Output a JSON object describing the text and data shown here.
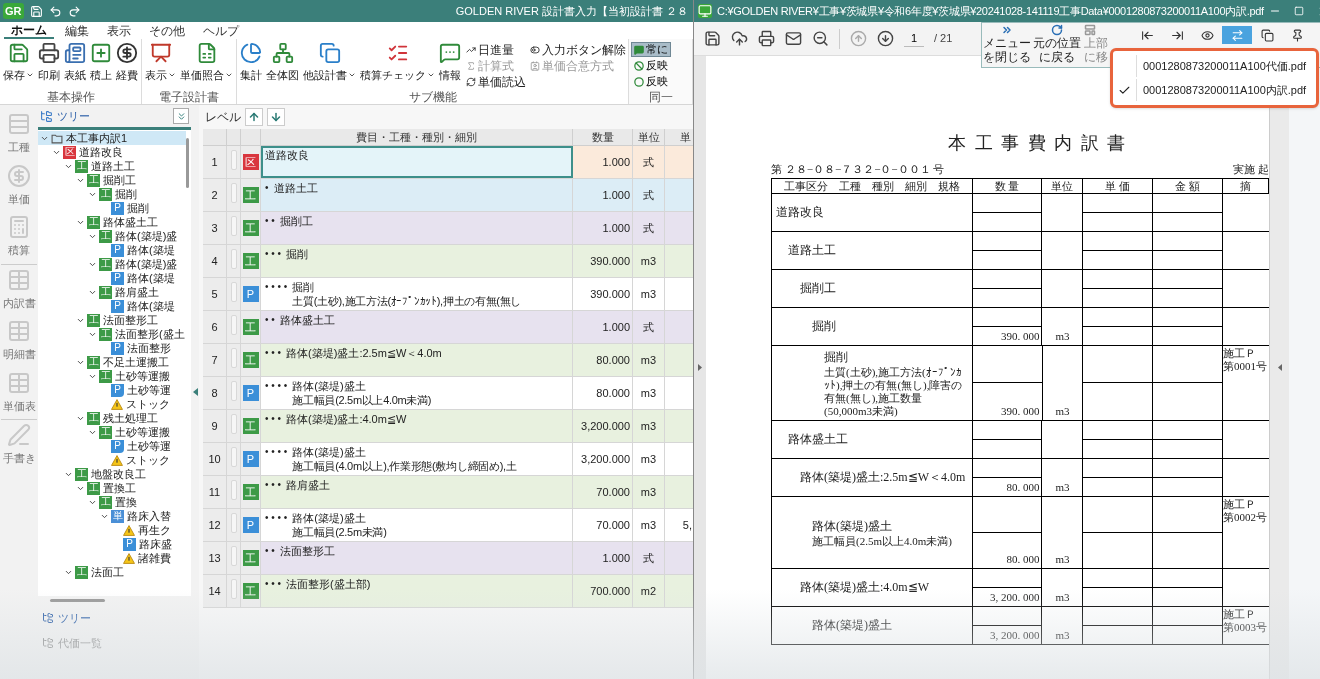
{
  "app": {
    "logo": "GR",
    "title": "GOLDEN RIVER 設計書入力【当初設計書 ２８",
    "tabs": [
      {
        "label": "ホーム",
        "selected": true
      },
      {
        "label": "編集",
        "selected": false
      },
      {
        "label": "表示",
        "selected": false
      },
      {
        "label": "その他",
        "selected": false
      },
      {
        "label": "ヘルプ",
        "selected": false
      }
    ],
    "ribbon": [
      {
        "label": "基本操作",
        "buttons": [
          {
            "label": "保存",
            "dropdown": true
          },
          {
            "label": "印刷",
            "dropdown": false
          },
          {
            "label": "表紙",
            "dropdown": false
          },
          {
            "label": "積上",
            "dropdown": false
          },
          {
            "label": "経費",
            "dropdown": false
          }
        ]
      },
      {
        "label": "電子設計書",
        "buttons": [
          {
            "label": "表示",
            "dropdown": true
          },
          {
            "label": "単価照合",
            "dropdown": true
          }
        ]
      },
      {
        "label": "サブ機能",
        "buttons": [
          {
            "label": "集計",
            "dropdown": false
          },
          {
            "label": "全体図",
            "dropdown": false
          },
          {
            "label": "他設計書",
            "dropdown": true
          },
          {
            "label": "積算チェック",
            "dropdown": true
          },
          {
            "label": "情報",
            "dropdown": false
          }
        ],
        "small": [
          {
            "label": "日進量",
            "disabled": false
          },
          {
            "label": "計算式",
            "disabled": true
          },
          {
            "label": "単価読込",
            "disabled": false
          },
          {
            "label": "入力ボタン解除",
            "disabled": false
          },
          {
            "label": "単価合意方式",
            "disabled": true
          }
        ]
      },
      {
        "label": "同一",
        "items": [
          {
            "label": "常に",
            "selected": true
          },
          {
            "label": "反映",
            "selected": false
          },
          {
            "label": "反映",
            "selected": false
          }
        ]
      }
    ],
    "nav": [
      "工種",
      "単価",
      "積算",
      "内訳書",
      "明細書",
      "単価表",
      "手書き"
    ],
    "tree": {
      "title": "ツリー",
      "nodes": [
        {
          "label": "本工事内訳1",
          "kind": "root",
          "expanded": true,
          "selected": true,
          "children": [
            {
              "label": "道路改良",
              "kind": "kubun",
              "badge": "区",
              "expanded": true,
              "selected": false,
              "children": [
                {
                  "label": "道路土工",
                  "kind": "kou",
                  "badge": "工",
                  "expanded": true,
                  "selected": false,
                  "children": [
                    {
                      "label": "掘削工",
                      "kind": "kou",
                      "badge": "工",
                      "expanded": true,
                      "selected": false,
                      "children": [
                        {
                          "label": "掘削",
                          "kind": "kou",
                          "badge": "工",
                          "expanded": true,
                          "selected": false,
                          "children": [
                            {
                              "label": "掘削",
                              "kind": "p",
                              "badge": "P",
                              "expanded": false,
                              "selected": false
                            }
                          ]
                        }
                      ]
                    },
                    {
                      "label": "路体盛土工",
                      "kind": "kou",
                      "badge": "工",
                      "expanded": true,
                      "selected": false,
                      "children": [
                        {
                          "label": "路体(築堤)盛",
                          "kind": "kou",
                          "badge": "工",
                          "expanded": true,
                          "selected": false,
                          "children": [
                            {
                              "label": "路体(築堤",
                              "kind": "p",
                              "badge": "P",
                              "expanded": false,
                              "selected": false
                            }
                          ]
                        },
                        {
                          "label": "路体(築堤)盛",
                          "kind": "kou",
                          "badge": "工",
                          "expanded": true,
                          "selected": false,
                          "children": [
                            {
                              "label": "路体(築堤",
                              "kind": "p",
                              "badge": "P",
                              "expanded": false,
                              "selected": false
                            }
                          ]
                        },
                        {
                          "label": "路肩盛土",
                          "kind": "kou",
                          "badge": "工",
                          "expanded": true,
                          "selected": false,
                          "children": [
                            {
                              "label": "路体(築堤",
                              "kind": "p",
                              "badge": "P",
                              "expanded": false,
                              "selected": false
                            }
                          ]
                        }
                      ]
                    },
                    {
                      "label": "法面整形工",
                      "kind": "kou",
                      "badge": "工",
                      "expanded": true,
                      "selected": false,
                      "children": [
                        {
                          "label": "法面整形(盛土",
                          "kind": "kou",
                          "badge": "工",
                          "expanded": true,
                          "selected": false,
                          "children": [
                            {
                              "label": "法面整形",
                              "kind": "p",
                              "badge": "P",
                              "expanded": false,
                              "selected": false
                            }
                          ]
                        }
                      ]
                    },
                    {
                      "label": "不足土運搬工",
                      "kind": "kou",
                      "badge": "工",
                      "expanded": true,
                      "selected": false,
                      "children": [
                        {
                          "label": "土砂等運搬",
                          "kind": "kou",
                          "badge": "工",
                          "expanded": true,
                          "selected": false,
                          "children": [
                            {
                              "label": "土砂等運",
                              "kind": "pedit",
                              "badge": "P",
                              "expanded": false,
                              "selected": false
                            },
                            {
                              "label": "ストック",
                              "kind": "warn",
                              "expanded": false,
                              "selected": false
                            }
                          ]
                        }
                      ]
                    },
                    {
                      "label": "残土処理工",
                      "kind": "kou",
                      "badge": "工",
                      "expanded": true,
                      "selected": false,
                      "children": [
                        {
                          "label": "土砂等運搬",
                          "kind": "kou",
                          "badge": "工",
                          "expanded": true,
                          "selected": false,
                          "children": [
                            {
                              "label": "土砂等運",
                              "kind": "pedit",
                              "badge": "P",
                              "expanded": false,
                              "selected": false
                            },
                            {
                              "label": "ストック",
                              "kind": "warn",
                              "expanded": false,
                              "selected": false
                            }
                          ]
                        }
                      ]
                    }
                  ]
                },
                {
                  "label": "地盤改良工",
                  "kind": "kou",
                  "badge": "工",
                  "expanded": true,
                  "selected": false,
                  "children": [
                    {
                      "label": "置換工",
                      "kind": "kou",
                      "badge": "工",
                      "expanded": true,
                      "selected": false,
                      "children": [
                        {
                          "label": "置換",
                          "kind": "kou",
                          "badge": "工",
                          "expanded": true,
                          "selected": false,
                          "children": [
                            {
                              "label": "路床入替",
                              "kind": "tan",
                              "badge": "単",
                              "expanded": true,
                              "selected": false,
                              "children": [
                                {
                                  "label": "再生ク",
                                  "kind": "warn",
                                  "expanded": false,
                                  "selected": false
                                },
                                {
                                  "label": "路床盛",
                                  "kind": "p",
                                  "badge": "P",
                                  "expanded": false,
                                  "selected": false
                                },
                                {
                                  "label": "諸雑費",
                                  "kind": "warn",
                                  "expanded": false,
                                  "selected": false
                                }
                              ]
                            }
                          ]
                        }
                      ]
                    }
                  ]
                },
                {
                  "label": "法面工",
                  "kind": "kou",
                  "badge": "工",
                  "expanded": true,
                  "selected": false
                }
              ]
            }
          ]
        }
      ]
    },
    "bottom_tabs": [
      "ツリー",
      "代価一覧"
    ],
    "grid": {
      "level_label": "レベル",
      "columns": [
        "費目・工種・種別・細別",
        "数量",
        "単位",
        "単"
      ],
      "rows": [
        {
          "no": "1",
          "kind": "kubun",
          "badge": "区",
          "name": "道路改良",
          "qty": "1.000",
          "unit": "式",
          "color": "#fbeadb",
          "selected": true
        },
        {
          "no": "2",
          "kind": "kou",
          "badge": "工",
          "marker": "•",
          "name": "道路土工",
          "qty": "1.000",
          "unit": "式",
          "color": "#dcedf6",
          "selected": false
        },
        {
          "no": "3",
          "kind": "kou",
          "badge": "工",
          "marker": "• •",
          "name": "掘削工",
          "qty": "1.000",
          "unit": "式",
          "color": "#e7e2ef",
          "selected": false
        },
        {
          "no": "4",
          "kind": "kou",
          "badge": "工",
          "marker": "• • •",
          "name": "掘削",
          "qty": "390.000",
          "unit": "m3",
          "color": "#e8f1df",
          "selected": false
        },
        {
          "no": "5",
          "kind": "p",
          "badge": "P",
          "marker": "• • • •",
          "name": "掘削",
          "detail": "土質(土砂),施工方法(ｵｰﾌﾟﾝｶｯﾄ),押土の有無(無し",
          "qty": "390.000",
          "unit": "m3",
          "color": "#ffffff",
          "selected": false
        },
        {
          "no": "6",
          "kind": "kou",
          "badge": "工",
          "marker": "• •",
          "name": "路体盛土工",
          "qty": "1.000",
          "unit": "式",
          "color": "#e7e2ef",
          "selected": false
        },
        {
          "no": "7",
          "kind": "kou",
          "badge": "工",
          "marker": "• • •",
          "name": "路体(築堤)盛土:2.5m≦W＜4.0m",
          "qty": "80.000",
          "unit": "m3",
          "color": "#e8f1df",
          "selected": false
        },
        {
          "no": "8",
          "kind": "p",
          "badge": "P",
          "marker": "• • • •",
          "name": "路体(築堤)盛土",
          "detail": "施工幅員(2.5m以上4.0m未満)",
          "qty": "80.000",
          "unit": "m3",
          "color": "#ffffff",
          "selected": false
        },
        {
          "no": "9",
          "kind": "kou",
          "badge": "工",
          "marker": "• • •",
          "name": "路体(築堤)盛土:4.0m≦W",
          "qty": "3,200.000",
          "unit": "m3",
          "color": "#e8f1df",
          "selected": false
        },
        {
          "no": "10",
          "kind": "p",
          "badge": "P",
          "marker": "• • • •",
          "name": "路体(築堤)盛土",
          "detail": "施工幅員(4.0m以上),作業形態(敷均し締固め),土",
          "qty": "3,200.000",
          "unit": "m3",
          "color": "#ffffff",
          "selected": false
        },
        {
          "no": "11",
          "kind": "kou",
          "badge": "工",
          "marker": "• • •",
          "name": "路肩盛土",
          "qty": "70.000",
          "unit": "m3",
          "color": "#e8f1df",
          "selected": false
        },
        {
          "no": "12",
          "kind": "p",
          "badge": "P",
          "marker": "• • • •",
          "name": "路体(築堤)盛土",
          "detail": "施工幅員(2.5m未満)",
          "qty": "70.000",
          "unit": "m3",
          "price": "5,",
          "color": "#ffffff",
          "selected": false
        },
        {
          "no": "13",
          "kind": "kou",
          "badge": "工",
          "marker": "• •",
          "name": "法面整形工",
          "qty": "1.000",
          "unit": "式",
          "color": "#e7e2ef",
          "selected": false
        },
        {
          "no": "14",
          "kind": "kou",
          "badge": "工",
          "marker": "• • •",
          "name": "法面整形(盛土部)",
          "qty": "700.000",
          "unit": "m2",
          "color": "#e8f1df",
          "selected": false
        }
      ]
    }
  },
  "viewer": {
    "title": "C:¥GOLDEN RIVER¥工事¥茨城県¥令和6年度¥茨城県¥20241028-141119工事Data¥0001280873200011A100内訳.pdf",
    "page": "1",
    "page_count": "/ 21",
    "menu_tools": [
      {
        "lines": [
          "メニュー",
          "を閉じる"
        ],
        "disabled": false
      },
      {
        "lines": [
          "元の位置",
          "に戻る"
        ],
        "disabled": false
      },
      {
        "lines": [
          "上部",
          "に移"
        ],
        "disabled": true
      }
    ],
    "icon_tools": [
      {
        "selected": false
      },
      {
        "selected": false
      },
      {
        "selected": false
      },
      {
        "selected": true
      },
      {
        "selected": false
      },
      {
        "selected": false
      }
    ],
    "files": [
      {
        "label": "0001280873200011A100代価.pdf",
        "checked": false
      },
      {
        "label": "0001280873200011A100内訳.pdf",
        "checked": true
      }
    ],
    "document": {
      "title": "本 工 事 費 内 訳 書",
      "number": "第 ２８−０８−７３２−０−００１ 号",
      "corner": "実施 起",
      "columns": [
        "工事区分　工種　種別　細別　規格",
        "数 量",
        "単位",
        "単 価",
        "金 額",
        "摘"
      ],
      "rows": [
        {
          "name": "道路改良",
          "children": [
            {
              "name": "道路土工",
              "children": [
                {
                  "name": "掘削工",
                  "children": [
                    {
                      "name": "掘削",
                      "qty": "390. 000",
                      "unit": "m3",
                      "children": [
                        {
                          "name": "掘削",
                          "detail": "土質(土砂),施工方法(ｵｰﾌﾟﾝｶｯﾄ),押土の有無(無し),障害の有無(無し),施工数量(50,000m3未満)",
                          "qty": "390. 000",
                          "unit": "m3",
                          "remark": [
                            "施工Ｐ",
                            "第0001号"
                          ]
                        }
                      ]
                    }
                  ]
                }
              ]
            },
            {
              "name": "路体盛土工",
              "children": [
                {
                  "name": "路体(築堤)盛土:2.5m≦W＜4.0m",
                  "qty": "80. 000",
                  "unit": "m3",
                  "children": [
                    {
                      "name": "路体(築堤)盛土",
                      "detail": "施工幅員(2.5m以上4.0m未満)",
                      "qty": "80. 000",
                      "unit": "m3",
                      "remark": [
                        "施工Ｐ",
                        "第0002号"
                      ]
                    }
                  ]
                },
                {
                  "name": "路体(築堤)盛土:4.0m≦W",
                  "qty": "3, 200. 000",
                  "unit": "m3",
                  "children": [
                    {
                      "name": "路体(築堤)盛土",
                      "qty": "3, 200. 000",
                      "unit": "m3",
                      "remark": [
                        "施工Ｐ",
                        "第0003号"
                      ]
                    }
                  ]
                }
              ]
            }
          ]
        }
      ]
    }
  }
}
